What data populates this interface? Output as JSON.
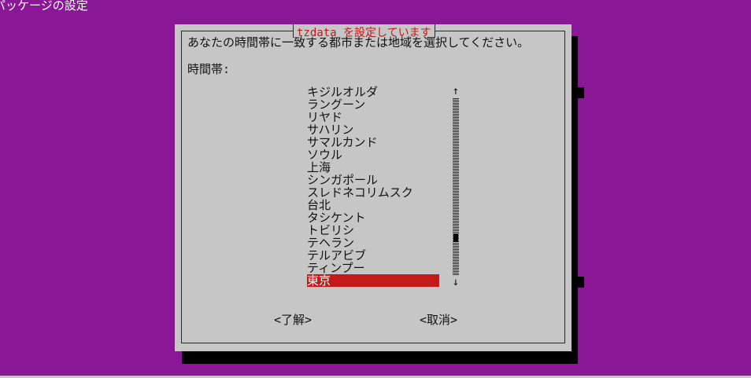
{
  "screen": {
    "title": "パッケージの設定"
  },
  "dialog": {
    "title": "tzdata を設定しています",
    "prompt": "あなたの時間帯に一致する都市または地域を選択してください。",
    "field_label": "時間帯:",
    "timezones": [
      "キジルオルダ",
      "ラングーン",
      "リヤド",
      "サハリン",
      "サマルカンド",
      "ソウル",
      "上海",
      "シンガポール",
      "スレドネコリムスク",
      "台北",
      "タシケント",
      "トビリシ",
      "テヘラン",
      "テルアビブ",
      "ティンプー",
      "東京"
    ],
    "selected_timezone": "東京",
    "scroll_up_glyph": "↑",
    "scroll_down_glyph": "↓",
    "scroll_position": 0.8,
    "ok_label": "<了解>",
    "cancel_label": "<取消>"
  },
  "colors": {
    "background": "#8a1896",
    "dialog": "#c6c6c6",
    "accent": "#c41a1a",
    "text": "#111111"
  }
}
